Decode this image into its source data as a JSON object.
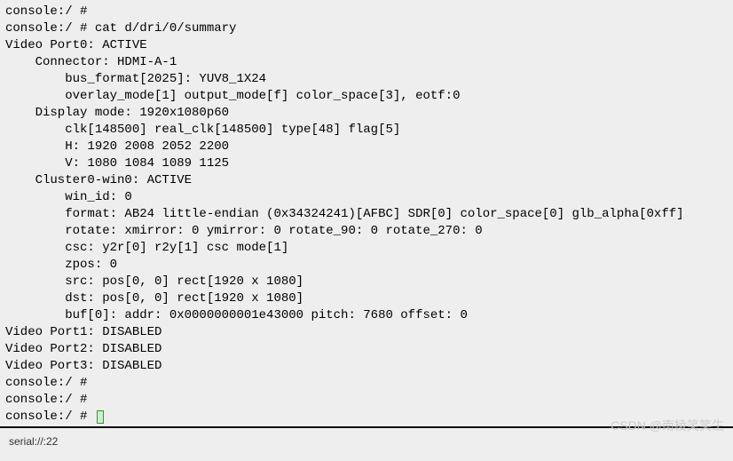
{
  "terminal": {
    "lines": [
      "console:/ #",
      "console:/ # cat d/dri/0/summary",
      "Video Port0: ACTIVE",
      "    Connector: HDMI-A-1",
      "        bus_format[2025]: YUV8_1X24",
      "        overlay_mode[1] output_mode[f] color_space[3], eotf:0",
      "    Display mode: 1920x1080p60",
      "        clk[148500] real_clk[148500] type[48] flag[5]",
      "        H: 1920 2008 2052 2200",
      "        V: 1080 1084 1089 1125",
      "    Cluster0-win0: ACTIVE",
      "        win_id: 0",
      "        format: AB24 little-endian (0x34324241)[AFBC] SDR[0] color_space[0] glb_alpha[0xff]",
      "        rotate: xmirror: 0 ymirror: 0 rotate_90: 0 rotate_270: 0",
      "        csc: y2r[0] r2y[1] csc mode[1]",
      "        zpos: 0",
      "        src: pos[0, 0] rect[1920 x 1080]",
      "        dst: pos[0, 0] rect[1920 x 1080]",
      "        buf[0]: addr: 0x0000000001e43000 pitch: 7680 offset: 0",
      "Video Port1: DISABLED",
      "Video Port2: DISABLED",
      "Video Port3: DISABLED",
      "console:/ #",
      "console:/ #"
    ],
    "prompt": "console:/ # "
  },
  "status": {
    "connection": "serial://:22"
  },
  "watermark": "CSDN @南棱笑笑生"
}
